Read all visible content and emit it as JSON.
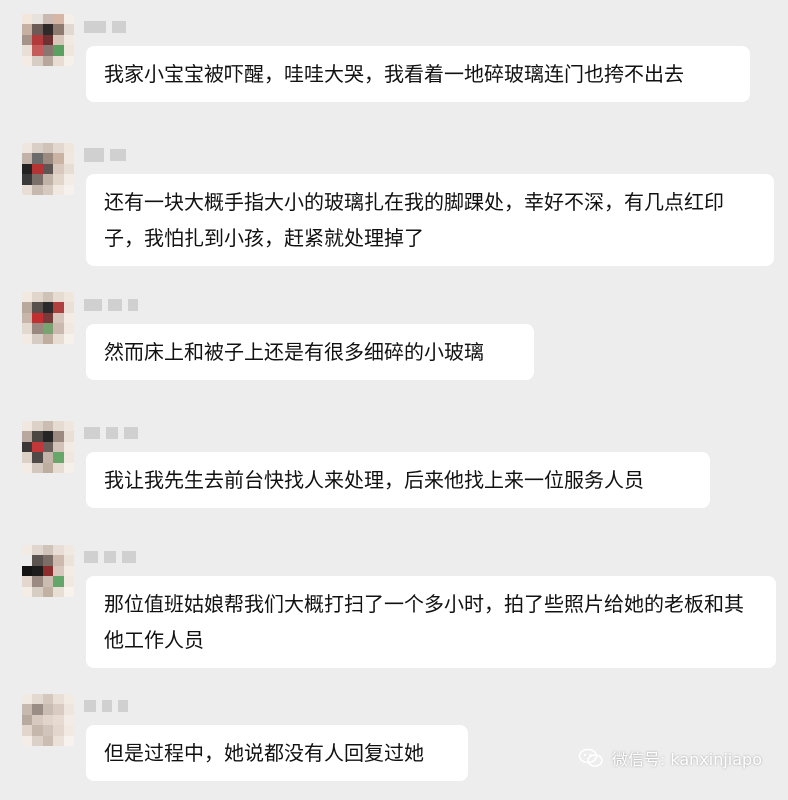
{
  "messages": [
    {
      "text": "我家小宝宝被吓醒，哇哇大哭，我看着一地碎玻璃连门也挎不出去"
    },
    {
      "text": "还有一块大概手指大小的玻璃扎在我的脚踝处，幸好不深，有几点红印子，我怕扎到小孩，赶紧就处理掉了"
    },
    {
      "text": "然而床上和被子上还是有很多细碎的小玻璃"
    },
    {
      "text": "我让我先生去前台快找人来处理，后来他找上来一位服务人员"
    },
    {
      "text": "那位值班姑娘帮我们大概打扫了一个多小时，拍了些照片给她的老板和其他工作人员"
    },
    {
      "text": "但是过程中，她说都没有人回复过她"
    }
  ],
  "watermark": {
    "text": "微信号: kanxinjiapo",
    "icon": "wechat-icon"
  },
  "colors": {
    "background": "#ededed",
    "bubble": "#ffffff",
    "text": "#111111"
  }
}
